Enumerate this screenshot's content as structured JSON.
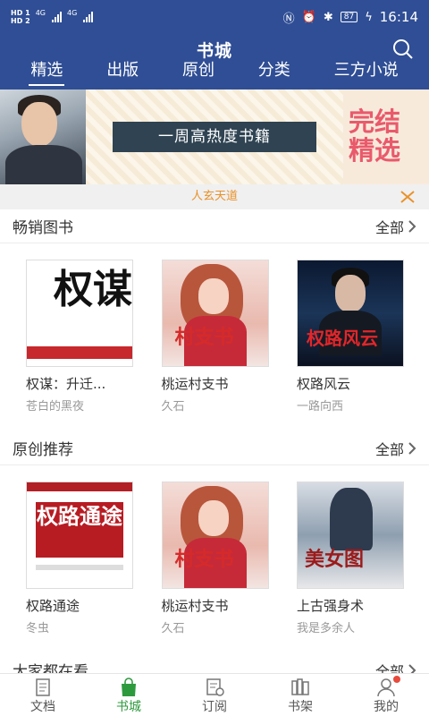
{
  "status_bar": {
    "hd1": "HD 1",
    "hd2": "HD 2",
    "net1": "4G",
    "net2": "4G",
    "battery": "87",
    "time": "16:14"
  },
  "header": {
    "title": "书城",
    "tabs": [
      "精选",
      "出版",
      "原创",
      "分类",
      "三方小说"
    ],
    "active_tab": "精选"
  },
  "banner": {
    "ribbon": "一周高热度书籍",
    "tag_line1": "完结",
    "tag_line2": "精选"
  },
  "notice": {
    "text": "人玄天道"
  },
  "sections": [
    {
      "title": "畅销图书",
      "more": "全部",
      "books": [
        {
          "title": "权谋：升迁...",
          "author": "苍白的黑夜",
          "cover_text": "权谋"
        },
        {
          "title": "桃运村支书",
          "author": "久石",
          "cover_text": "村支书"
        },
        {
          "title": "权路风云",
          "author": "一路向西",
          "cover_text": "权路风云"
        }
      ]
    },
    {
      "title": "原创推荐",
      "more": "全部",
      "books": [
        {
          "title": "权路通途",
          "author": "冬虫",
          "cover_text": "权路通途"
        },
        {
          "title": "桃运村支书",
          "author": "久石",
          "cover_text": "村支书"
        },
        {
          "title": "上古强身术",
          "author": "我是多余人",
          "cover_text": "美女图"
        }
      ]
    },
    {
      "title": "大家都在看",
      "more": "全部"
    }
  ],
  "tabbar": {
    "items": [
      "文档",
      "书城",
      "订阅",
      "书架",
      "我的"
    ],
    "active": "书城"
  },
  "colors": {
    "primary": "#2f4e95",
    "accent_green": "#2e9a3e",
    "notice_orange": "#e9922a",
    "badge_red": "#e84a3c"
  }
}
